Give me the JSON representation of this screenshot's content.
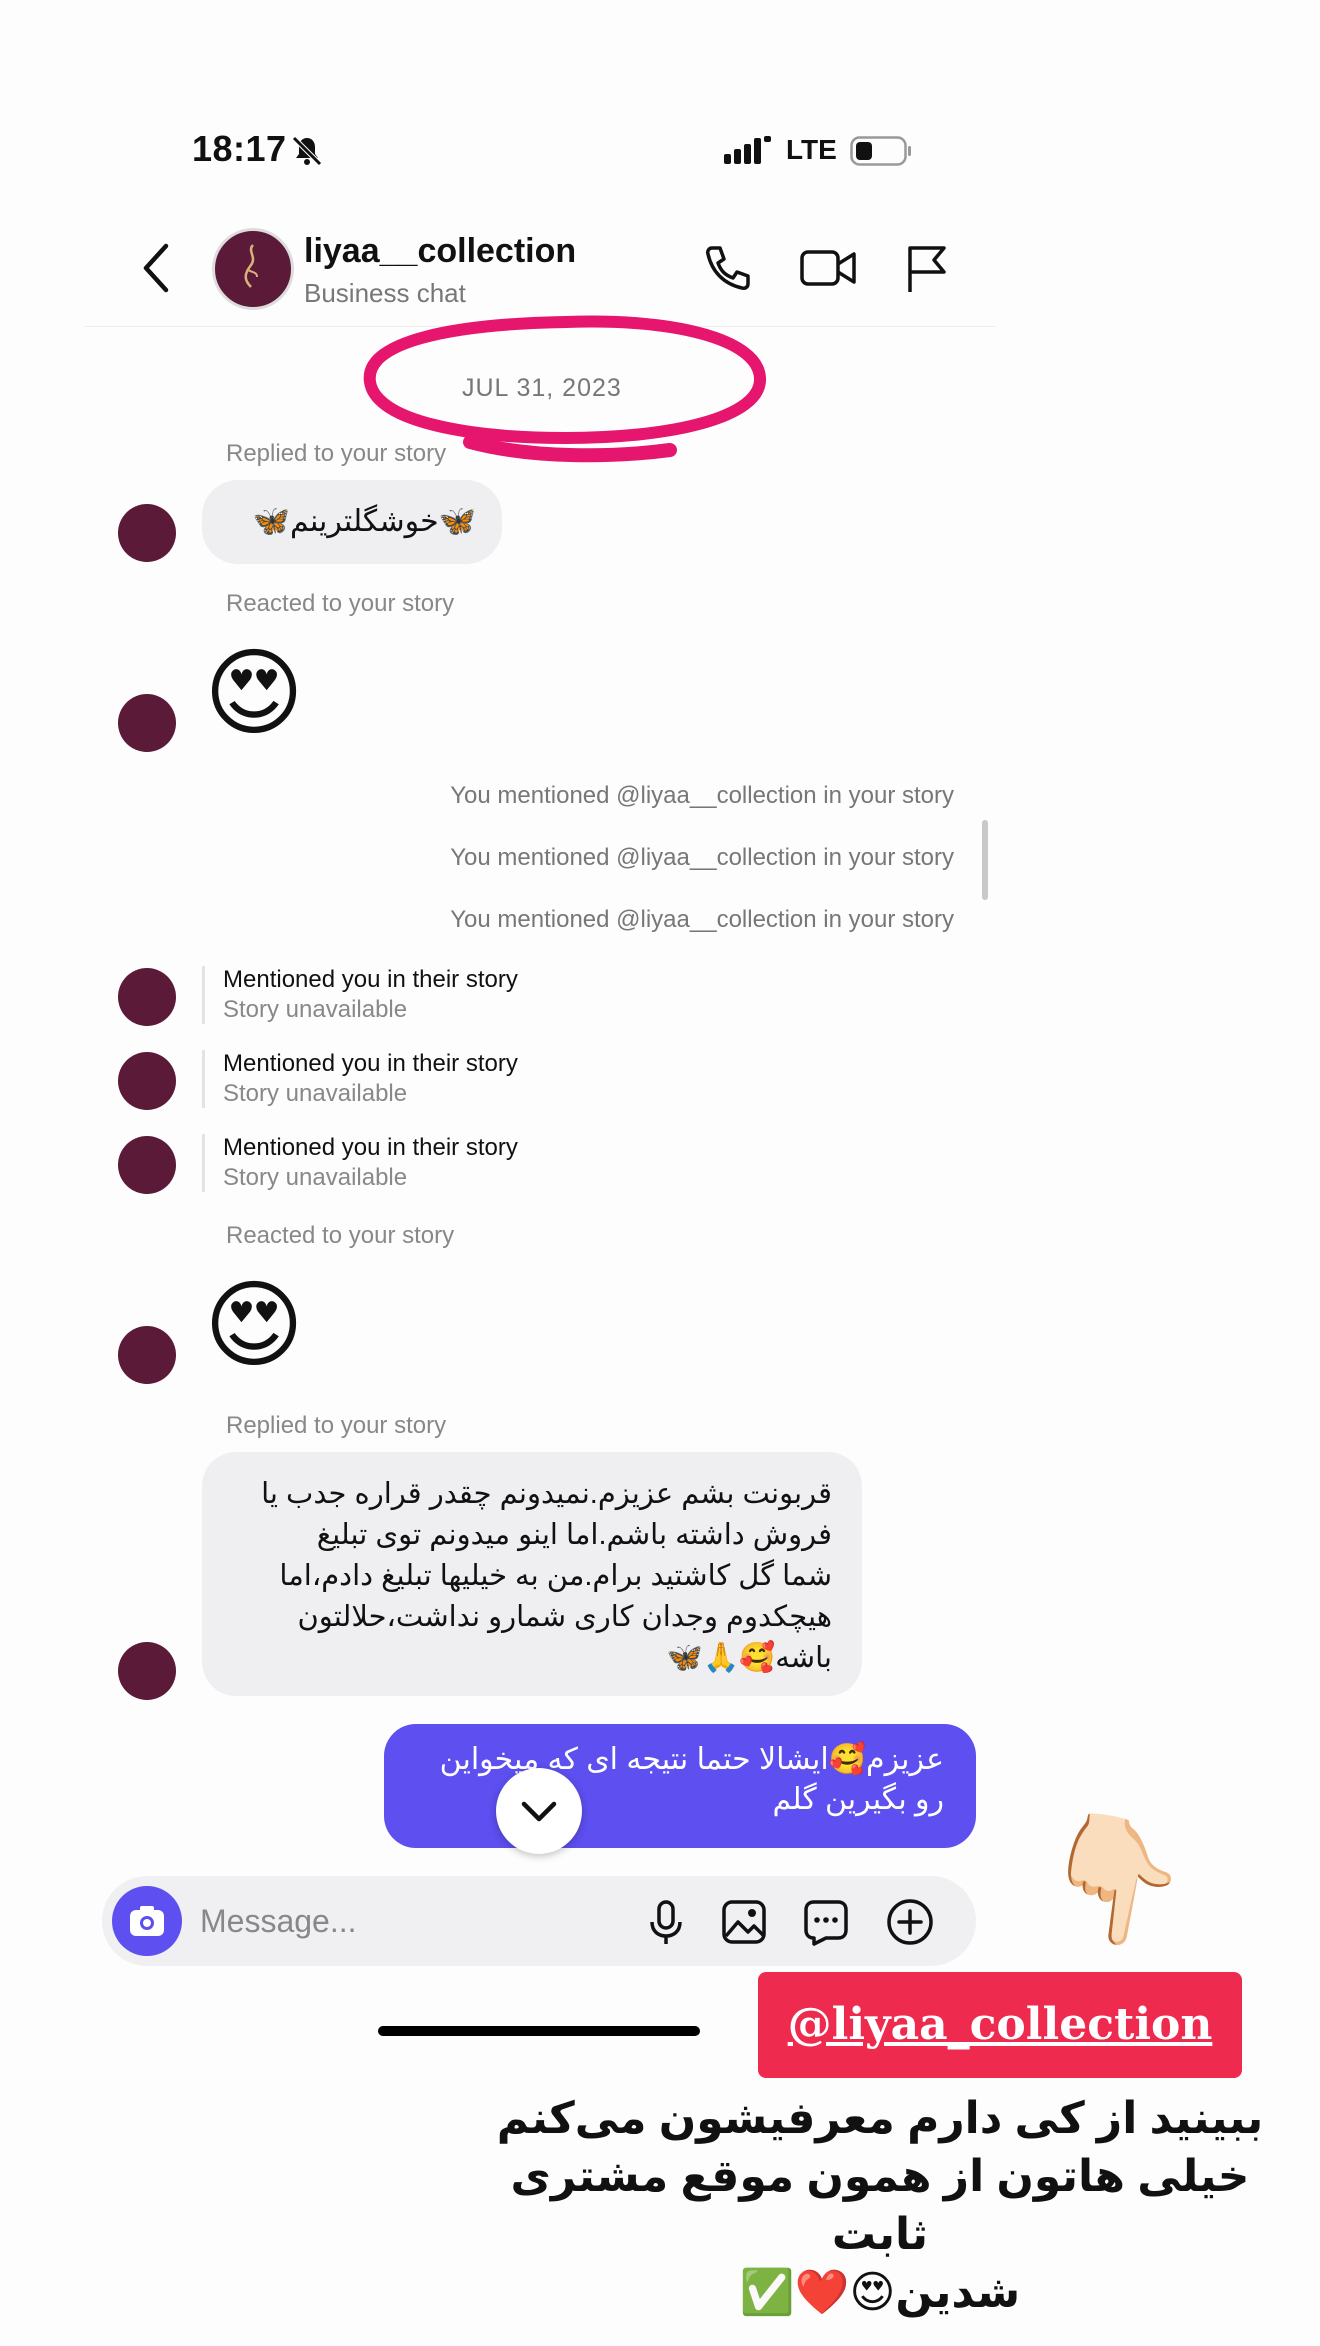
{
  "status_bar": {
    "time": "18:17",
    "network": "LTE"
  },
  "header": {
    "name": "liyaa__collection",
    "subtitle": "Business chat"
  },
  "date_separator": "JUL 31, 2023",
  "messages": {
    "replied_1": {
      "meta": "Replied to your story",
      "text": "🦋خوشگلترینم🦋"
    },
    "reacted_1": {
      "meta": "Reacted to your story",
      "emoji": "😍"
    },
    "mentions_out": [
      "You mentioned @liyaa__collection in your story",
      "You mentioned @liyaa__collection in your story",
      "You mentioned @liyaa__collection in your story"
    ],
    "mentions_in": [
      {
        "title": "Mentioned you in their story",
        "status": "Story unavailable"
      },
      {
        "title": "Mentioned you in their story",
        "status": "Story unavailable"
      },
      {
        "title": "Mentioned you in their story",
        "status": "Story unavailable"
      }
    ],
    "reacted_2": {
      "meta": "Reacted to your story",
      "emoji": "😍"
    },
    "replied_2": {
      "meta": "Replied to your story",
      "lines": [
        "قربونت بشم عزیزم.نمیدونم چقدر قراره جدب یا",
        "فروش داشته باشم.اما اینو میدونم توی تبلیغ",
        "شما گل کاشتید برام.من به خیلیها تبلیغ دادم،اما",
        "هیچکدوم وجدان کاری شمارو نداشت،حلالتون",
        "باشه🥰🙏🦋"
      ]
    },
    "sent": {
      "lines": [
        "عزیزم🥰ایشالا حتما نتیجه ای که میخواین",
        "رو بگیرین گلم"
      ]
    }
  },
  "composer": {
    "placeholder": "Message..."
  },
  "overlay": {
    "hand": "👇🏻",
    "tag": "@liyaa_collection",
    "caption": [
      "ببینید از کی دارم معرفیشون می‌کنم",
      "خیلی هاتون از همون موقع مشتری ثابت",
      "شدین😍❤️✅"
    ]
  },
  "colors": {
    "accent": "#5d4ff0",
    "highlight": "#e6156e",
    "tag_bg": "#ee2a4e",
    "avatar": "#5a1a38"
  }
}
